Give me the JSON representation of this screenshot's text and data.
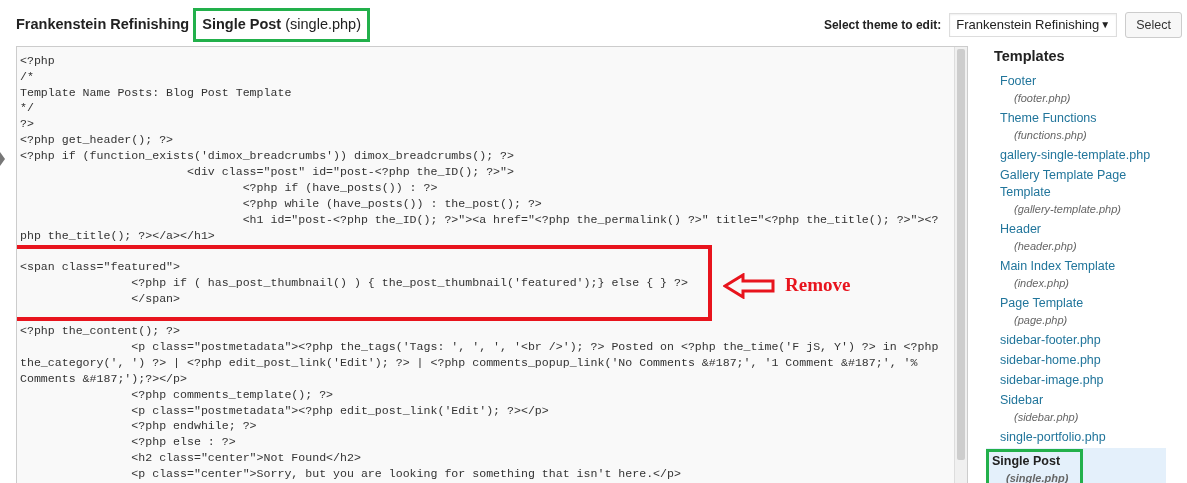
{
  "header": {
    "theme_name": "Frankenstein Refinishing",
    "file_title": "Single Post",
    "file_name": "(single.php)",
    "outlined": true
  },
  "theme_picker": {
    "label": "Select theme to edit:",
    "value": "Frankenstein Refinishing",
    "arrow": "▼",
    "button": "Select"
  },
  "editor": {
    "sections": [
      {
        "kind": "plain",
        "lines": [
          "<?php",
          "/*",
          "Template Name Posts: Blog Post Template",
          "*/",
          "?>",
          "<?php get_header(); ?>",
          "<?php if (function_exists('dimox_breadcrumbs')) dimox_breadcrumbs(); ?>",
          "                        <div class=\"post\" id=\"post-<?php the_ID(); ?>\">",
          "                                <?php if (have_posts()) : ?>",
          "                                <?php while (have_posts()) : the_post(); ?>",
          "                                <h1 id=\"post-<?php the_ID(); ?>\"><a href=\"<?php the_permalink() ?>\" title=\"<?php the_title(); ?>\"><?",
          "php the_title(); ?></a></h1>"
        ]
      },
      {
        "kind": "marked",
        "lines": [
          "<span class=\"featured\">",
          "                <?php if ( has_post_thumbnail() ) { the_post_thumbnail('featured');} else { } ?>",
          "                </span>"
        ]
      },
      {
        "kind": "plain",
        "lines": [
          "<?php the_content(); ?>",
          "                <p class=\"postmetadata\"><?php the_tags('Tags: ', ', ', '<br />'); ?> Posted on <?php the_time('F jS, Y') ?> in <?php",
          "the_category(', ') ?> | <?php edit_post_link('Edit'); ?> | <?php comments_popup_link('No Comments &#187;', '1 Comment &#187;', '%",
          "Comments &#187;');?></p>",
          "                <?php comments_template(); ?>",
          "                <p class=\"postmetadata\"><?php edit_post_link('Edit'); ?></p>",
          "                <?php endwhile; ?>",
          "                <?php else : ?>",
          "                <h2 class=\"center\">Not Found</h2>",
          "                <p class=\"center\">Sorry, but you are looking for something that isn't here.</p>"
        ]
      }
    ]
  },
  "annotation": {
    "label": "Remove"
  },
  "sidebar": {
    "title": "Templates",
    "items": [
      {
        "name": "Footer",
        "file": "(footer.php)",
        "selected": false
      },
      {
        "name": "Theme Functions",
        "file": "(functions.php)",
        "selected": false
      },
      {
        "name": "gallery-single-template.php",
        "selected": false
      },
      {
        "name": "Gallery Template Page Template",
        "file": "(gallery-template.php)",
        "selected": false
      },
      {
        "name": "Header",
        "file": "(header.php)",
        "selected": false
      },
      {
        "name": "Main Index Template",
        "file": "(index.php)",
        "selected": false
      },
      {
        "name": "Page Template",
        "file": "(page.php)",
        "selected": false
      },
      {
        "name": "sidebar-footer.php",
        "selected": false
      },
      {
        "name": "sidebar-home.php",
        "selected": false
      },
      {
        "name": "sidebar-image.php",
        "selected": false
      },
      {
        "name": "Sidebar",
        "file": "(sidebar.php)",
        "selected": false
      },
      {
        "name": "single-portfolio.php",
        "selected": false
      },
      {
        "name": "Single Post",
        "file": "(single.php)",
        "selected": true
      }
    ]
  }
}
